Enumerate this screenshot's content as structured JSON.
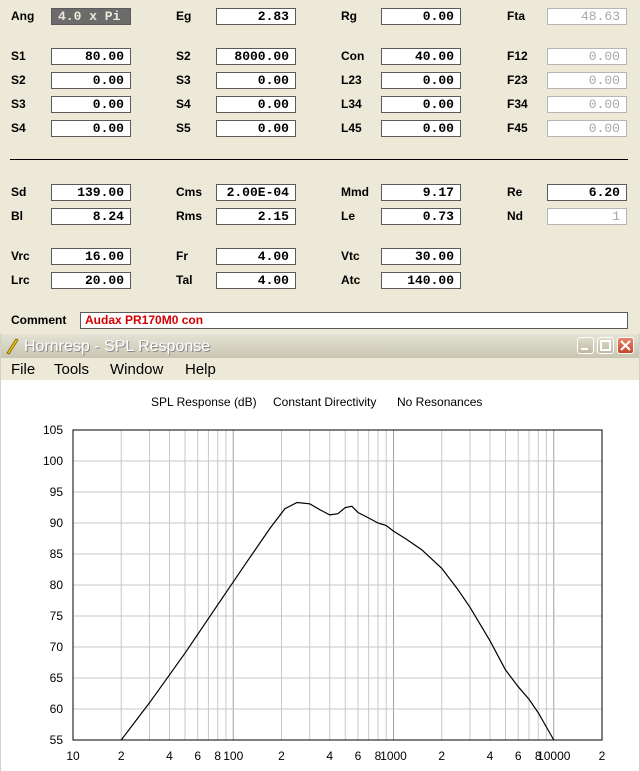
{
  "params": {
    "rows": [
      [
        {
          "label": "Ang",
          "value": "4.0 x Pi",
          "state": "selected"
        },
        {
          "label": "Eg",
          "value": "2.83"
        },
        {
          "label": "Rg",
          "value": "0.00"
        },
        {
          "label": "Fta",
          "value": "48.63",
          "state": "disabled"
        }
      ],
      [
        {
          "label": "S1",
          "value": "80.00"
        },
        {
          "label": "S2",
          "value": "8000.00"
        },
        {
          "label": "Con",
          "value": "40.00"
        },
        {
          "label": "F12",
          "value": "0.00",
          "state": "disabled"
        }
      ],
      [
        {
          "label": "S2",
          "value": "0.00"
        },
        {
          "label": "S3",
          "value": "0.00"
        },
        {
          "label": "L23",
          "value": "0.00"
        },
        {
          "label": "F23",
          "value": "0.00",
          "state": "disabled"
        }
      ],
      [
        {
          "label": "S3",
          "value": "0.00"
        },
        {
          "label": "S4",
          "value": "0.00"
        },
        {
          "label": "L34",
          "value": "0.00"
        },
        {
          "label": "F34",
          "value": "0.00",
          "state": "disabled"
        }
      ],
      [
        {
          "label": "S4",
          "value": "0.00"
        },
        {
          "label": "S5",
          "value": "0.00"
        },
        {
          "label": "L45",
          "value": "0.00"
        },
        {
          "label": "F45",
          "value": "0.00",
          "state": "disabled"
        }
      ],
      [
        {
          "label": "Sd",
          "value": "139.00"
        },
        {
          "label": "Cms",
          "value": "2.00E-04"
        },
        {
          "label": "Mmd",
          "value": "9.17"
        },
        {
          "label": "Re",
          "value": "6.20"
        }
      ],
      [
        {
          "label": "Bl",
          "value": "8.24"
        },
        {
          "label": "Rms",
          "value": "2.15"
        },
        {
          "label": "Le",
          "value": "0.73"
        },
        {
          "label": "Nd",
          "value": "1",
          "state": "disabled"
        }
      ],
      [
        {
          "label": "Vrc",
          "value": "16.00"
        },
        {
          "label": "Fr",
          "value": "4.00"
        },
        {
          "label": "Vtc",
          "value": "30.00"
        }
      ],
      [
        {
          "label": "Lrc",
          "value": "20.00"
        },
        {
          "label": "Tal",
          "value": "4.00"
        },
        {
          "label": "Atc",
          "value": "140.00"
        }
      ]
    ]
  },
  "comment": {
    "label": "Comment",
    "value": "Audax PR170M0 con"
  },
  "window": {
    "title": "Hornresp - SPL Response",
    "menu": [
      "File",
      "Tools",
      "Window",
      "Help"
    ]
  },
  "colors": {
    "panel": "#ece9d8",
    "comment_text": "#d40000",
    "disabled_text": "#a7a7a7",
    "grid": "#c8c8c8"
  },
  "chart_data": {
    "type": "line",
    "title_parts": [
      "SPL Response (dB)",
      "Constant Directivity",
      "No Resonances"
    ],
    "xscale": "log",
    "xlim": [
      10,
      20000
    ],
    "ylim": [
      55,
      105
    ],
    "yticks": [
      55,
      60,
      65,
      70,
      75,
      80,
      85,
      90,
      95,
      100,
      105
    ],
    "xtick_labels": [
      {
        "x": 10,
        "label": "10"
      },
      {
        "x": 20,
        "label": "2"
      },
      {
        "x": 40,
        "label": "4"
      },
      {
        "x": 60,
        "label": "6"
      },
      {
        "x": 80,
        "label": "8"
      },
      {
        "x": 100,
        "label": "100"
      },
      {
        "x": 200,
        "label": "2"
      },
      {
        "x": 400,
        "label": "4"
      },
      {
        "x": 600,
        "label": "6"
      },
      {
        "x": 800,
        "label": "8"
      },
      {
        "x": 1000,
        "label": "1000"
      },
      {
        "x": 2000,
        "label": "2"
      },
      {
        "x": 4000,
        "label": "4"
      },
      {
        "x": 6000,
        "label": "6"
      },
      {
        "x": 8000,
        "label": "8"
      },
      {
        "x": 10000,
        "label": "10000"
      },
      {
        "x": 20000,
        "label": "2"
      }
    ],
    "grid": true,
    "series": [
      {
        "x": [
          20,
          30,
          50,
          80,
          120,
          170,
          210,
          250,
          300,
          350,
          400,
          450,
          500,
          550,
          600,
          700,
          800,
          900,
          1000,
          1200,
          1500,
          2000,
          2500,
          3000,
          4000,
          5000,
          6000,
          7000,
          8000,
          9000,
          10000
        ],
        "y": [
          55,
          61,
          69,
          76.8,
          83.5,
          89.2,
          92.3,
          93.3,
          93.1,
          92.1,
          91.3,
          91.5,
          92.5,
          92.7,
          91.7,
          90.8,
          90,
          89.6,
          88.7,
          87.4,
          85.7,
          82.7,
          79.4,
          76.4,
          71,
          66.3,
          63.6,
          61.6,
          59.4,
          57.1,
          55
        ]
      }
    ]
  }
}
